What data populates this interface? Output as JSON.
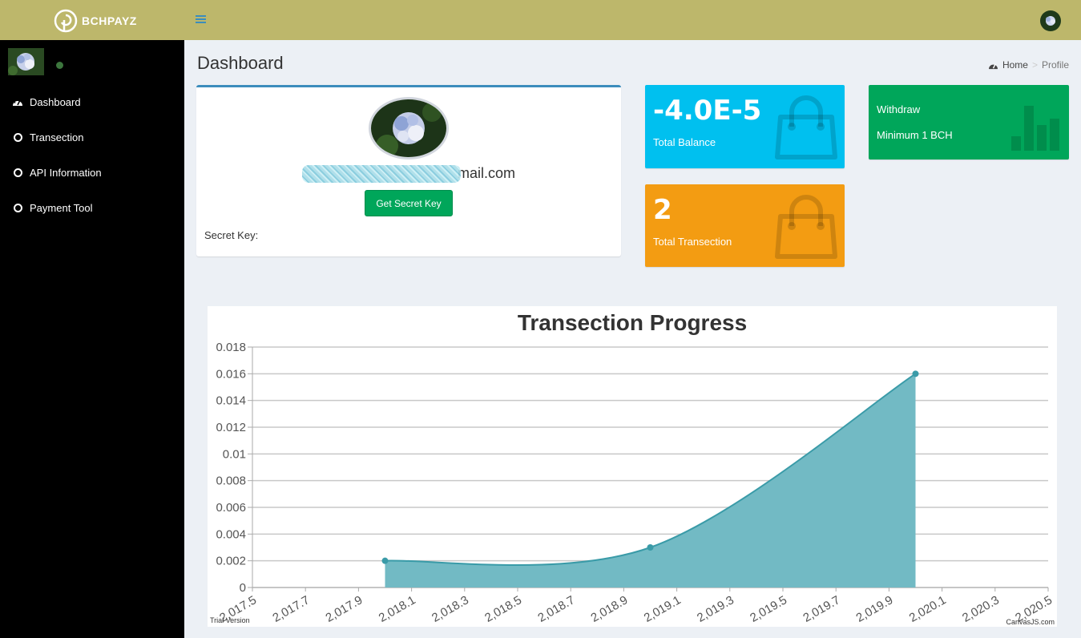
{
  "app": {
    "brand": "BCHPAYZ",
    "page_title": "Dashboard"
  },
  "breadcrumb": {
    "home": "Home",
    "separator": ">",
    "current": "Profile"
  },
  "sidebar": {
    "items": [
      {
        "label": "Dashboard",
        "icon": "dashboard-icon"
      },
      {
        "label": "Transection",
        "icon": "circle-icon"
      },
      {
        "label": "API Information",
        "icon": "circle-icon"
      },
      {
        "label": "Payment Tool",
        "icon": "circle-icon"
      }
    ]
  },
  "profile": {
    "email_visible": "mail.com",
    "button_label": "Get Secret Key",
    "secret_label": "Secret Key:"
  },
  "boxes": {
    "balance": {
      "value": "-4.0E-5",
      "label": "Total Balance",
      "color": "#00c0ef",
      "icon": "shopping-bag-icon"
    },
    "transactions": {
      "value": "2",
      "label": "Total Transection",
      "color": "#f39c12",
      "icon": "shopping-bag-icon"
    },
    "withdraw": {
      "title": "Withdraw",
      "subtitle": "Minimum 1 BCH",
      "color": "#00a65a",
      "icon": "bar-chart-icon"
    }
  },
  "colors": {
    "topbar": "#bdb76b",
    "sidebar": "#000000",
    "content_bg": "#ecf0f5",
    "area_fill": "#72bac4",
    "area_line": "#3a9ba8"
  },
  "chart_data": {
    "type": "area",
    "title": "Transection Progress",
    "xlabel": "",
    "ylabel": "",
    "x": [
      2018.0,
      2019.0,
      2020.0
    ],
    "y": [
      0.002,
      0.003,
      0.016
    ],
    "xlim": [
      2017.5,
      2020.5
    ],
    "ylim": [
      0,
      0.018
    ],
    "x_ticks": [
      "2,017.5",
      "2,017.7",
      "2,017.9",
      "2,018.1",
      "2,018.3",
      "2,018.5",
      "2,018.7",
      "2,018.9",
      "2,019.1",
      "2,019.3",
      "2,019.5",
      "2,019.7",
      "2,019.9",
      "2,020.1",
      "2,020.3",
      "2,020.5"
    ],
    "y_ticks": [
      "0",
      "0.002",
      "0.004",
      "0.006",
      "0.008",
      "0.01",
      "0.012",
      "0.014",
      "0.016",
      "0.018"
    ],
    "grid": true,
    "credits": {
      "left": "Trial Version",
      "right": "CanvasJS.com"
    }
  }
}
